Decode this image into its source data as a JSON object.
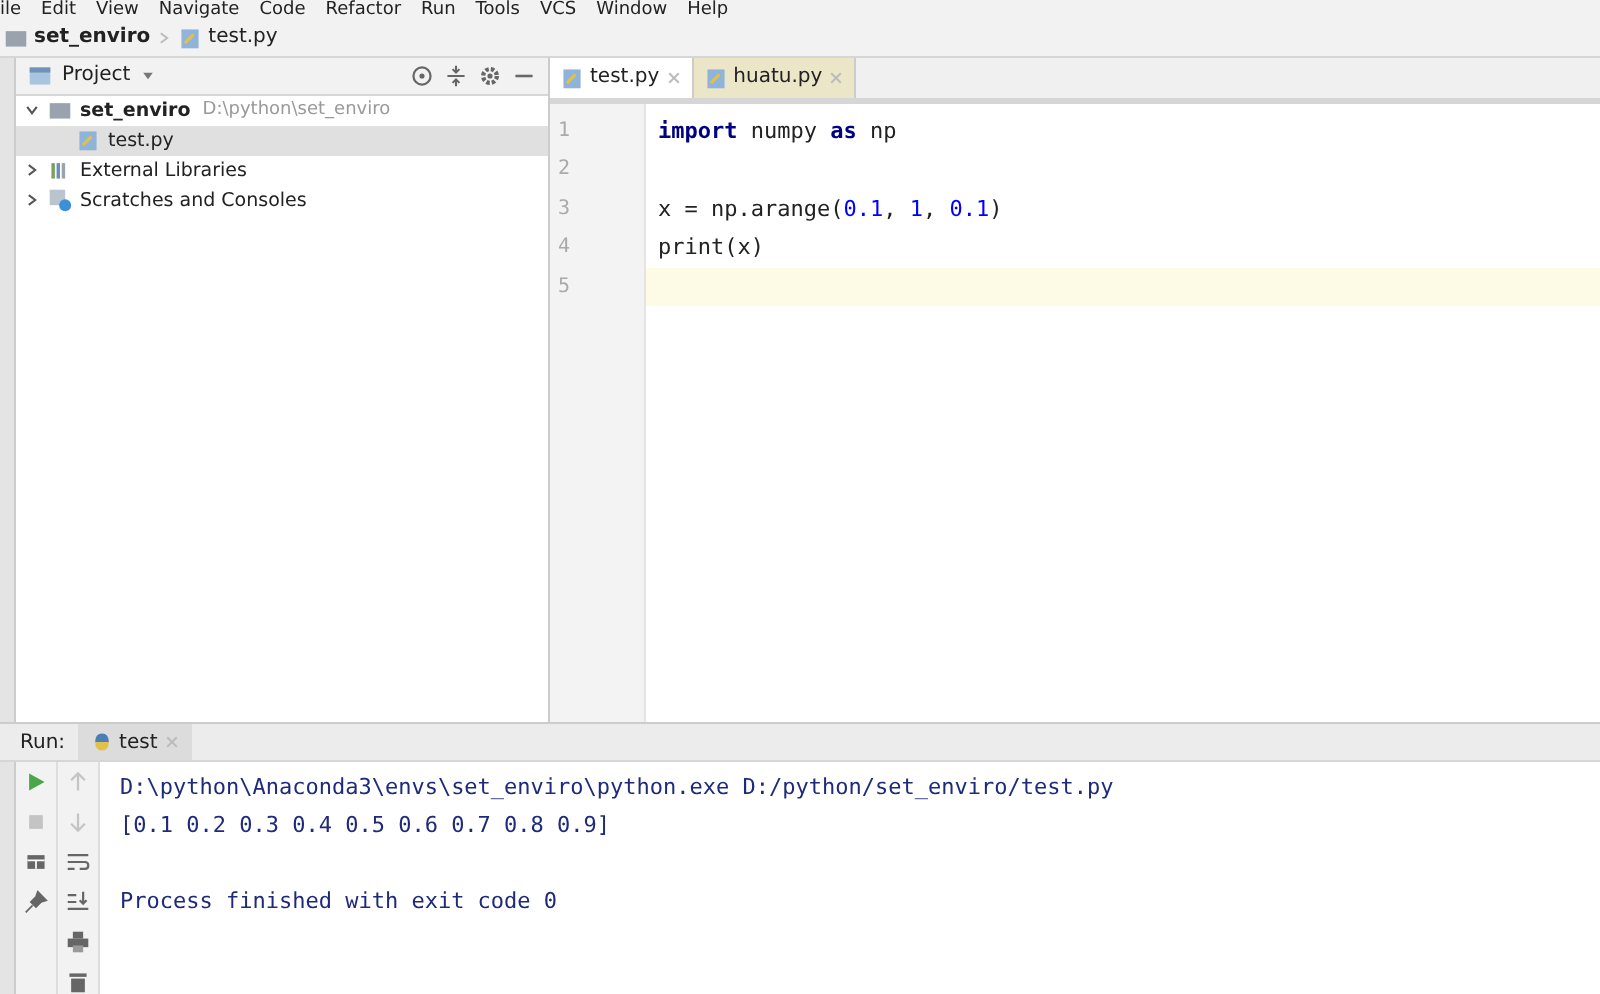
{
  "menu": [
    "ile",
    "Edit",
    "View",
    "Navigate",
    "Code",
    "Refactor",
    "Run",
    "Tools",
    "VCS",
    "Window",
    "Help"
  ],
  "breadcrumb": [
    "set_enviro",
    "test.py"
  ],
  "project_panel": {
    "title": "Project",
    "tree": [
      {
        "label": "set_enviro",
        "path": "D:\\python\\set_enviro",
        "kind": "folder",
        "expanded": true,
        "selected": false,
        "children": [
          {
            "label": "test.py",
            "kind": "python",
            "selected": true
          }
        ]
      },
      {
        "label": "External Libraries",
        "kind": "library",
        "expanded": false,
        "selected": false
      },
      {
        "label": "Scratches and Consoles",
        "kind": "scratch",
        "expanded": false,
        "selected": false
      }
    ]
  },
  "editor_tabs": [
    {
      "label": "test.py",
      "selected": true
    },
    {
      "label": "huatu.py",
      "selected": false
    }
  ],
  "code_lines": [
    {
      "number": "1",
      "current": false,
      "tokens": [
        {
          "text": "import",
          "kind": "keyword"
        },
        {
          "text": " numpy ",
          "kind": "plain"
        },
        {
          "text": "as",
          "kind": "keyword"
        },
        {
          "text": " np",
          "kind": "plain"
        }
      ]
    },
    {
      "number": "2",
      "current": false
    },
    {
      "number": "3",
      "current": false,
      "tokens": [
        {
          "text": "x = np.arange(",
          "kind": "plain"
        },
        {
          "text": "0.1",
          "kind": "number"
        },
        {
          "text": ", ",
          "kind": "plain"
        },
        {
          "text": "1",
          "kind": "number"
        },
        {
          "text": ", ",
          "kind": "plain"
        },
        {
          "text": "0.1",
          "kind": "number"
        },
        {
          "text": ")",
          "kind": "plain"
        }
      ]
    },
    {
      "number": "4",
      "current": false,
      "tokens": [
        {
          "text": "print(x)",
          "kind": "plain"
        }
      ]
    },
    {
      "number": "5",
      "current": true
    }
  ],
  "run_panel": {
    "label": "Run:",
    "tab": "test",
    "console": [
      {
        "text": "D:\\python\\Anaconda3\\envs\\set_enviro\\python.exe D:/python/set_enviro/test.py",
        "kind": "command"
      },
      {
        "text": "[0.1 0.2 0.3 0.4 0.5 0.6 0.7 0.8 0.9]",
        "kind": "output"
      },
      {
        "text": "Process finished with exit code 0",
        "kind": "status"
      }
    ]
  }
}
